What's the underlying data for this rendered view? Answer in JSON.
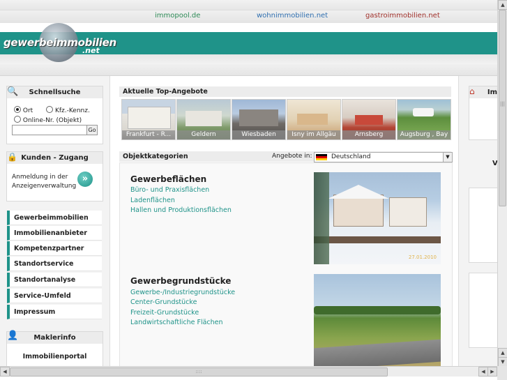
{
  "topnav": {
    "link1": "immopool.de",
    "link2": "wohnimmobilien.net",
    "link3": "gastroimmobilien.net",
    "color1": "#2e8b57",
    "color2": "#2f6fb0",
    "color3": "#a0302a"
  },
  "logo": {
    "main": "gewerbeimmobilien",
    "suffix": ".net"
  },
  "quicksearch": {
    "title": "Schnellsuche",
    "radio_ort": "Ort",
    "radio_kfz": "Kfz.-Kennz.",
    "radio_online": "Online-Nr. (Objekt)",
    "go": "Go"
  },
  "customer": {
    "title": "Kunden - Zugang",
    "text": "Anmeldung in der Anzeigenverwaltung"
  },
  "menu": [
    "Gewerbeimmobilien",
    "Immobilienanbieter",
    "Kompetenzpartner",
    "Standortservice",
    "Standortanalyse",
    "Service-Umfeld",
    "Impressum"
  ],
  "makler": {
    "title": "Maklerinfo",
    "link": "Immobilienportal"
  },
  "top": {
    "title": "Aktuelle Top-Angebote",
    "thumbs": [
      "Frankfurt - R...",
      "Geldern",
      "Wiesbaden",
      "Isny im Allgäu",
      "Arnsberg",
      "Augsburg , Bay"
    ]
  },
  "categories": {
    "title": "Objektkategorien",
    "offers_label": "Angebote in:",
    "country": "Deutschland",
    "photo1_date": "27.01.2010",
    "groups": [
      {
        "heading": "Gewerbeflächen",
        "links": [
          "Büro- und Praxisflächen",
          "Ladenflächen",
          "Hallen und Produktionsflächen"
        ]
      },
      {
        "heading": "Gewerbegrundstücke",
        "links": [
          "Gewerbe-/Industriegrundstücke",
          "Center-Grundstücke",
          "Freizeit-Grundstücke",
          "Landwirtschaftliche Flächen"
        ]
      }
    ]
  },
  "right": {
    "title_partial": "Im",
    "v_partial": "V"
  },
  "scrollbars": {
    "vertical_thumb": "|||",
    "horizontal_thumb": "::::"
  }
}
